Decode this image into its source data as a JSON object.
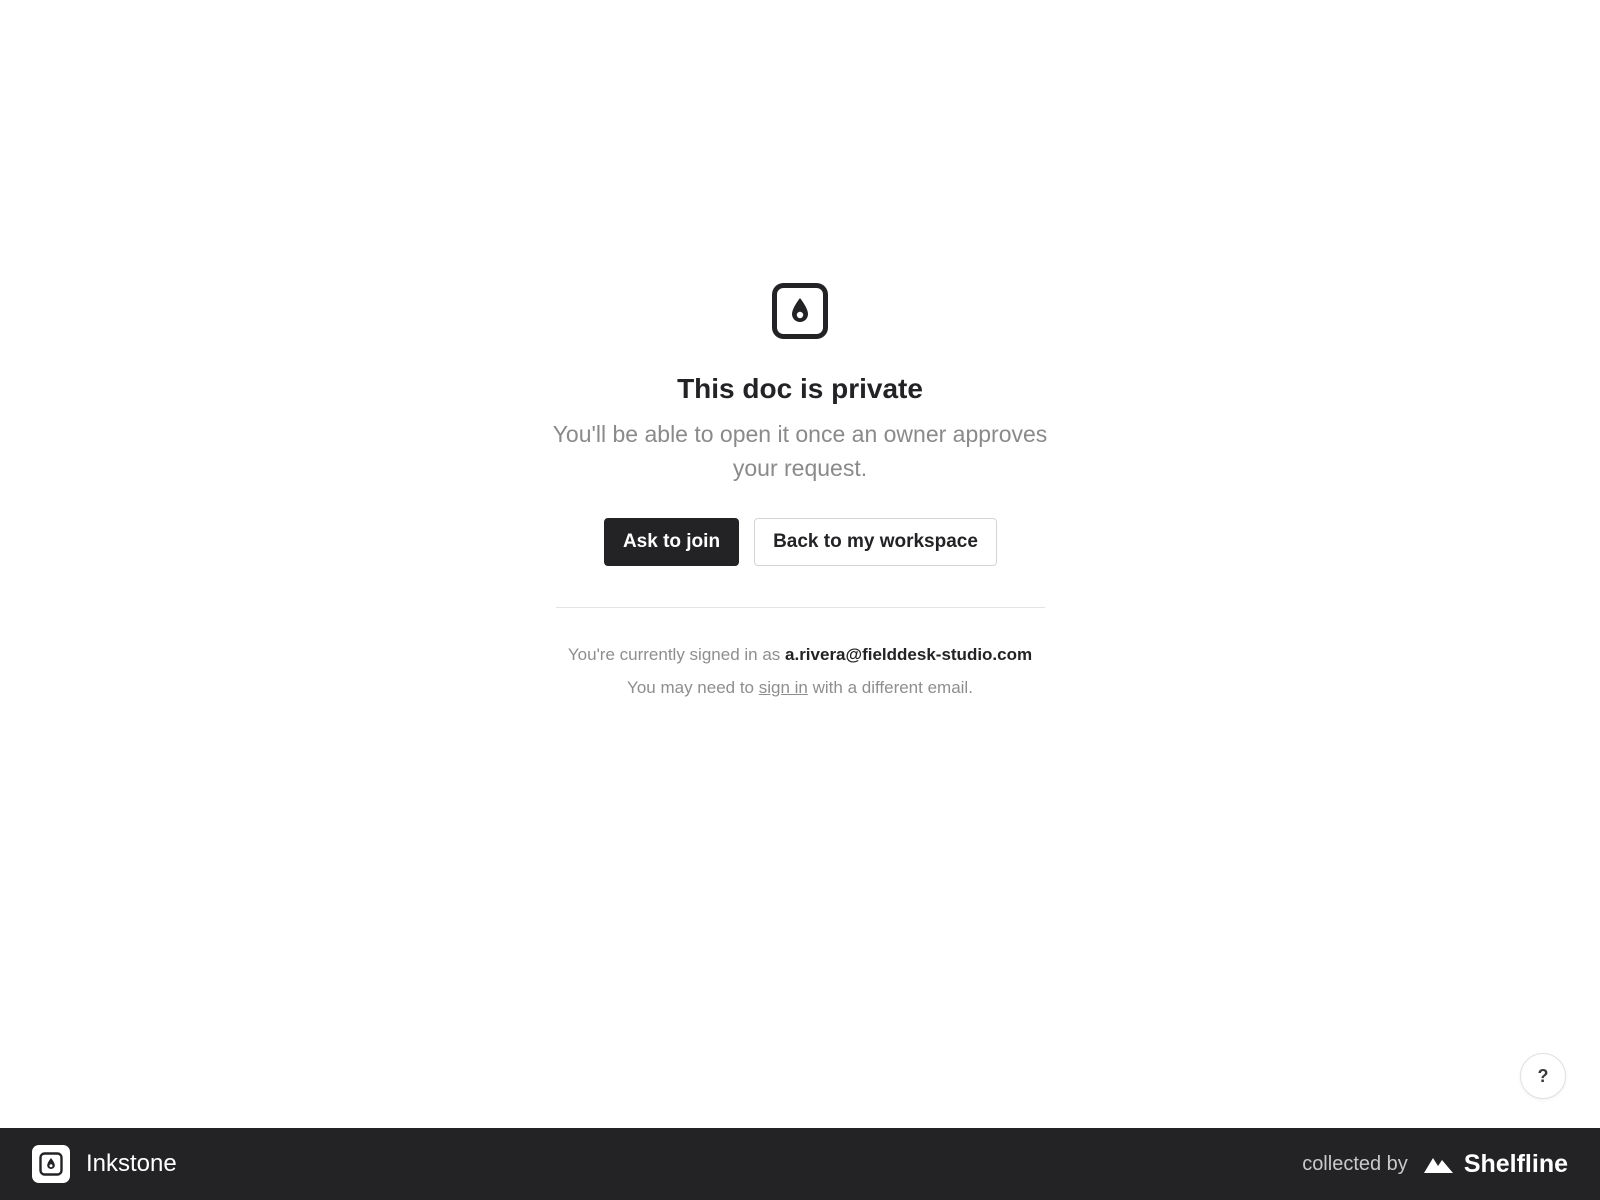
{
  "main": {
    "icon": "doc-drop-icon",
    "title": "This doc is private",
    "subtitle": "You'll be able to open it once an owner approves your request.",
    "primary_button": "Ask to join",
    "secondary_button": "Back to my workspace",
    "signed_in_prefix": "You're currently signed in as ",
    "signed_in_email": "a.rivera@fielddesk-studio.com",
    "help_prefix": "You may need to ",
    "help_link": "sign in",
    "help_suffix": " with a different email."
  },
  "help_button": {
    "label": "?"
  },
  "footer": {
    "brand_name": "Inkstone",
    "brand_icon": "inkstone-logo-icon",
    "collected_by": "collected by",
    "collector_name": "Shelfline",
    "collector_icon": "mountain-logo-icon"
  },
  "colors": {
    "primary": "#232326",
    "muted_text": "#8a8a8a",
    "footer_bg": "#232326",
    "border": "#d4d4d4"
  }
}
